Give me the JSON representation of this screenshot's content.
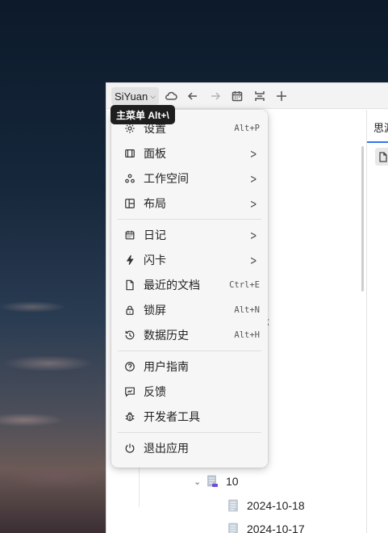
{
  "app": {
    "brand_label": "SiYuan",
    "tooltip": "主菜单 Alt+\\"
  },
  "right_pane": {
    "tab_label": "思源"
  },
  "tree": {
    "partial_text": "示",
    "folder": {
      "label": "10"
    },
    "docs": [
      {
        "label": "2024-10-18"
      },
      {
        "label": "2024-10-17"
      }
    ]
  },
  "menu": {
    "items": [
      {
        "label": "设置",
        "shortcut": "Alt+P",
        "icon": "gear-icon"
      },
      {
        "label": "面板",
        "shortcut": "",
        "icon": "panel-icon",
        "submenu": true
      },
      {
        "label": "工作空间",
        "shortcut": "",
        "icon": "workspace-icon",
        "submenu": true
      },
      {
        "label": "布局",
        "shortcut": "",
        "icon": "layout-icon",
        "submenu": true
      },
      {
        "label": "日记",
        "shortcut": "",
        "icon": "calendar-icon",
        "submenu": true
      },
      {
        "label": "闪卡",
        "shortcut": "",
        "icon": "flash-icon",
        "submenu": true
      },
      {
        "label": "最近的文档",
        "shortcut": "Ctrl+E",
        "icon": "document-icon"
      },
      {
        "label": "锁屏",
        "shortcut": "Alt+N",
        "icon": "lock-icon"
      },
      {
        "label": "数据历史",
        "shortcut": "Alt+H",
        "icon": "history-icon"
      },
      {
        "label": "用户指南",
        "shortcut": "",
        "icon": "help-icon"
      },
      {
        "label": "反馈",
        "shortcut": "",
        "icon": "feedback-icon"
      },
      {
        "label": "开发者工具",
        "shortcut": "",
        "icon": "bug-icon"
      },
      {
        "label": "退出应用",
        "shortcut": "",
        "icon": "power-icon"
      }
    ]
  },
  "colors": {
    "accent": "#3575f0",
    "menu_bg": "#f6f6f6",
    "tooltip_bg": "#1e1e1e"
  }
}
